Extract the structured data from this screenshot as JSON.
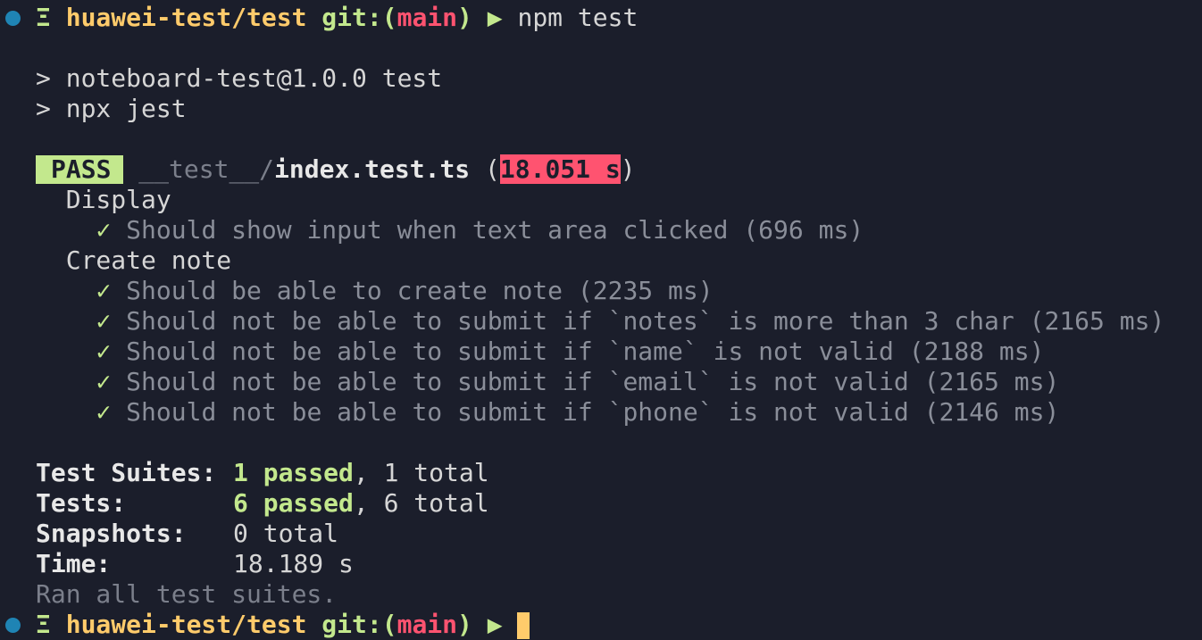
{
  "prompt": {
    "glyph": "Ξ",
    "path": "huawei-test/test",
    "git_label": "git:",
    "branch": "main",
    "arrow": "▶",
    "command": "npm test"
  },
  "npm_output": [
    "> noteboard-test@1.0.0 test",
    "> npx jest"
  ],
  "result": {
    "status": "PASS",
    "file_dir": "__test__/",
    "file_name": "index.test.ts",
    "duration": "18.051 s",
    "groups": [
      {
        "name": "Display",
        "tests": [
          "Should show input when text area clicked (696 ms)"
        ]
      },
      {
        "name": "Create note",
        "tests": [
          "Should be able to create note (2235 ms)",
          "Should not be able to submit if `notes` is more than 3 char (2165 ms)",
          "Should not be able to submit if `name` is not valid (2188 ms)",
          "Should not be able to submit if `email` is not valid (2165 ms)",
          "Should not be able to submit if `phone` is not valid (2146 ms)"
        ]
      }
    ],
    "check_glyph": "✓"
  },
  "summary": {
    "suites_label": "Test Suites:",
    "suites_passed": "1 passed",
    "suites_total": ", 1 total",
    "tests_label": "Tests:",
    "tests_passed": "6 passed",
    "tests_total": ", 6 total",
    "snapshots_label": "Snapshots:",
    "snapshots_value": "0 total",
    "time_label": "Time:",
    "time_value": "18.189 s",
    "footer": "Ran all test suites."
  },
  "colors": {
    "background": "#1b1e2b",
    "path": "#ffcb6b",
    "git": "#c3e88d",
    "branch": "#ff5370",
    "pass_badge": "#c3e88d",
    "slow_badge": "#ff5370"
  }
}
